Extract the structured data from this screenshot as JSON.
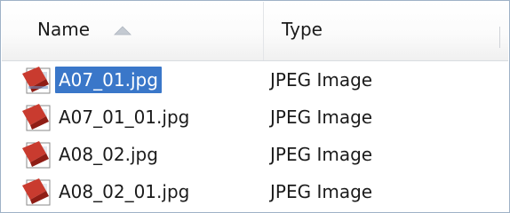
{
  "columns": {
    "name_label": "Name",
    "type_label": "Type"
  },
  "files": [
    {
      "name": "A07_01.jpg",
      "type": "JPEG Image",
      "selected": true,
      "icon": "jpeg-file-icon"
    },
    {
      "name": "A07_01_01.jpg",
      "type": "JPEG Image",
      "selected": false,
      "icon": "jpeg-file-icon"
    },
    {
      "name": "A08_02.jpg",
      "type": "JPEG Image",
      "selected": false,
      "icon": "jpeg-file-icon"
    },
    {
      "name": "A08_02_01.jpg",
      "type": "JPEG Image",
      "selected": false,
      "icon": "jpeg-file-icon"
    }
  ],
  "colors": {
    "selection": "#3a77c9",
    "border": "#9fb2c7"
  }
}
